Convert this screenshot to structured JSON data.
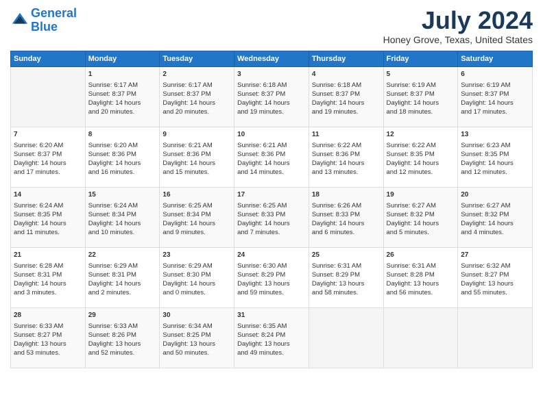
{
  "header": {
    "logo_line1": "General",
    "logo_line2": "Blue",
    "month_year": "July 2024",
    "location": "Honey Grove, Texas, United States"
  },
  "days_of_week": [
    "Sunday",
    "Monday",
    "Tuesday",
    "Wednesday",
    "Thursday",
    "Friday",
    "Saturday"
  ],
  "weeks": [
    [
      {
        "day": "",
        "content": ""
      },
      {
        "day": "1",
        "content": "Sunrise: 6:17 AM\nSunset: 8:37 PM\nDaylight: 14 hours\nand 20 minutes."
      },
      {
        "day": "2",
        "content": "Sunrise: 6:17 AM\nSunset: 8:37 PM\nDaylight: 14 hours\nand 20 minutes."
      },
      {
        "day": "3",
        "content": "Sunrise: 6:18 AM\nSunset: 8:37 PM\nDaylight: 14 hours\nand 19 minutes."
      },
      {
        "day": "4",
        "content": "Sunrise: 6:18 AM\nSunset: 8:37 PM\nDaylight: 14 hours\nand 19 minutes."
      },
      {
        "day": "5",
        "content": "Sunrise: 6:19 AM\nSunset: 8:37 PM\nDaylight: 14 hours\nand 18 minutes."
      },
      {
        "day": "6",
        "content": "Sunrise: 6:19 AM\nSunset: 8:37 PM\nDaylight: 14 hours\nand 17 minutes."
      }
    ],
    [
      {
        "day": "7",
        "content": "Sunrise: 6:20 AM\nSunset: 8:37 PM\nDaylight: 14 hours\nand 17 minutes."
      },
      {
        "day": "8",
        "content": "Sunrise: 6:20 AM\nSunset: 8:36 PM\nDaylight: 14 hours\nand 16 minutes."
      },
      {
        "day": "9",
        "content": "Sunrise: 6:21 AM\nSunset: 8:36 PM\nDaylight: 14 hours\nand 15 minutes."
      },
      {
        "day": "10",
        "content": "Sunrise: 6:21 AM\nSunset: 8:36 PM\nDaylight: 14 hours\nand 14 minutes."
      },
      {
        "day": "11",
        "content": "Sunrise: 6:22 AM\nSunset: 8:36 PM\nDaylight: 14 hours\nand 13 minutes."
      },
      {
        "day": "12",
        "content": "Sunrise: 6:22 AM\nSunset: 8:35 PM\nDaylight: 14 hours\nand 12 minutes."
      },
      {
        "day": "13",
        "content": "Sunrise: 6:23 AM\nSunset: 8:35 PM\nDaylight: 14 hours\nand 12 minutes."
      }
    ],
    [
      {
        "day": "14",
        "content": "Sunrise: 6:24 AM\nSunset: 8:35 PM\nDaylight: 14 hours\nand 11 minutes."
      },
      {
        "day": "15",
        "content": "Sunrise: 6:24 AM\nSunset: 8:34 PM\nDaylight: 14 hours\nand 10 minutes."
      },
      {
        "day": "16",
        "content": "Sunrise: 6:25 AM\nSunset: 8:34 PM\nDaylight: 14 hours\nand 9 minutes."
      },
      {
        "day": "17",
        "content": "Sunrise: 6:25 AM\nSunset: 8:33 PM\nDaylight: 14 hours\nand 7 minutes."
      },
      {
        "day": "18",
        "content": "Sunrise: 6:26 AM\nSunset: 8:33 PM\nDaylight: 14 hours\nand 6 minutes."
      },
      {
        "day": "19",
        "content": "Sunrise: 6:27 AM\nSunset: 8:32 PM\nDaylight: 14 hours\nand 5 minutes."
      },
      {
        "day": "20",
        "content": "Sunrise: 6:27 AM\nSunset: 8:32 PM\nDaylight: 14 hours\nand 4 minutes."
      }
    ],
    [
      {
        "day": "21",
        "content": "Sunrise: 6:28 AM\nSunset: 8:31 PM\nDaylight: 14 hours\nand 3 minutes."
      },
      {
        "day": "22",
        "content": "Sunrise: 6:29 AM\nSunset: 8:31 PM\nDaylight: 14 hours\nand 2 minutes."
      },
      {
        "day": "23",
        "content": "Sunrise: 6:29 AM\nSunset: 8:30 PM\nDaylight: 14 hours\nand 0 minutes."
      },
      {
        "day": "24",
        "content": "Sunrise: 6:30 AM\nSunset: 8:29 PM\nDaylight: 13 hours\nand 59 minutes."
      },
      {
        "day": "25",
        "content": "Sunrise: 6:31 AM\nSunset: 8:29 PM\nDaylight: 13 hours\nand 58 minutes."
      },
      {
        "day": "26",
        "content": "Sunrise: 6:31 AM\nSunset: 8:28 PM\nDaylight: 13 hours\nand 56 minutes."
      },
      {
        "day": "27",
        "content": "Sunrise: 6:32 AM\nSunset: 8:27 PM\nDaylight: 13 hours\nand 55 minutes."
      }
    ],
    [
      {
        "day": "28",
        "content": "Sunrise: 6:33 AM\nSunset: 8:27 PM\nDaylight: 13 hours\nand 53 minutes."
      },
      {
        "day": "29",
        "content": "Sunrise: 6:33 AM\nSunset: 8:26 PM\nDaylight: 13 hours\nand 52 minutes."
      },
      {
        "day": "30",
        "content": "Sunrise: 6:34 AM\nSunset: 8:25 PM\nDaylight: 13 hours\nand 50 minutes."
      },
      {
        "day": "31",
        "content": "Sunrise: 6:35 AM\nSunset: 8:24 PM\nDaylight: 13 hours\nand 49 minutes."
      },
      {
        "day": "",
        "content": ""
      },
      {
        "day": "",
        "content": ""
      },
      {
        "day": "",
        "content": ""
      }
    ]
  ]
}
